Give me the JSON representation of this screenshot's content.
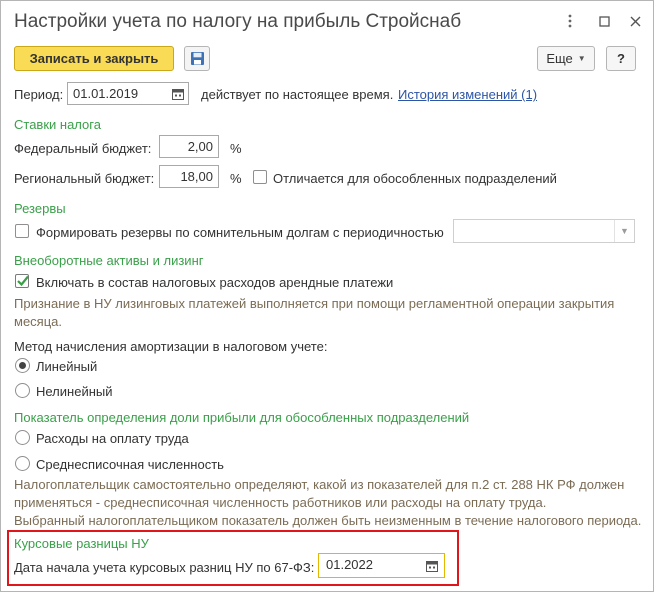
{
  "window": {
    "title": "Настройки учета по налогу на прибыль Стройснаб"
  },
  "toolbar": {
    "write_close_label": "Записать и закрыть",
    "more_label": "Еще",
    "help_label": "?"
  },
  "period": {
    "label": "Период:",
    "value": "01.01.2019",
    "status_text": "действует по настоящее время.",
    "history_link": "История изменений (1)"
  },
  "tax_rates": {
    "title": "Ставки налога",
    "federal_label": "Федеральный бюджет:",
    "federal_value": "2,00",
    "regional_label": "Региональный бюджет:",
    "regional_value": "18,00",
    "percent": "%",
    "separate_units_label": "Отличается для обособленных подразделений",
    "separate_units_checked": false
  },
  "reserves": {
    "title": "Резервы",
    "form_reserves_label": "Формировать резервы по сомнительным долгам с периодичностью",
    "form_reserves_checked": false,
    "periodicity_value": ""
  },
  "fixed_assets": {
    "title": "Внеоборотные активы и лизинг",
    "include_lease_label": "Включать в состав налоговых расходов арендные платежи",
    "include_lease_checked": true,
    "note_line1": "Признание в НУ лизинговых платежей выполняется при помощи регламентной операции закрытия",
    "note_line2": "месяца.",
    "depreciation_label": "Метод начисления амортизации в налоговом учете:",
    "linear_label": "Линейный",
    "nonlinear_label": "Нелинейный",
    "selected_method": "linear"
  },
  "profit_share": {
    "title": "Показатель определения доли прибыли для обособленных подразделений",
    "labor_costs_label": "Расходы на оплату труда",
    "avg_headcount_label": "Среднесписочная численность",
    "note_line1": "Налогоплательщик самостоятельно определяют, какой из показателей для п.2 ст. 288 НК РФ должен",
    "note_line2": "применяться - среднесписочная численность работников или расходы на оплату труда.",
    "note_line3": "Выбранный налогоплательщиком показатель должен быть неизменным в течение налогового периода."
  },
  "fx_diff": {
    "title": "Курсовые разницы НУ",
    "start_date_label": "Дата начала учета курсовых разниц НУ по 67-ФЗ:",
    "start_date_value": "01.2022"
  },
  "colors": {
    "primary_button": "#fadb55",
    "group_title": "#3aa04a",
    "link": "#2d55a6",
    "note_text": "#7b6c55",
    "highlight_border": "#e0161a",
    "active_field_border": "#e5b800"
  }
}
